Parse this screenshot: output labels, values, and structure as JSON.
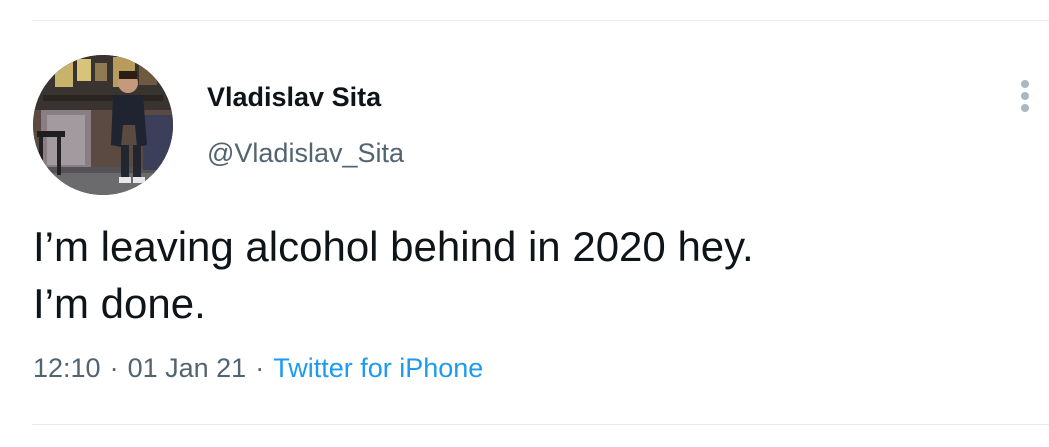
{
  "tweet": {
    "author": {
      "name": "Vladislav Sita",
      "handle": "@Vladislav_Sita",
      "avatar_icon": "profile-photo"
    },
    "text_lines": [
      "I’m leaving alcohol behind in 2020 hey.",
      "I’m done."
    ],
    "time": "12:10",
    "date": "01 Jan 21",
    "separator": "·",
    "source": "Twitter for iPhone",
    "more_icon": "vertical-ellipsis-icon"
  },
  "colors": {
    "text_primary": "#0f1419",
    "text_secondary": "#536471",
    "link": "#1d9bf0",
    "divider": "#e6ecf0"
  }
}
